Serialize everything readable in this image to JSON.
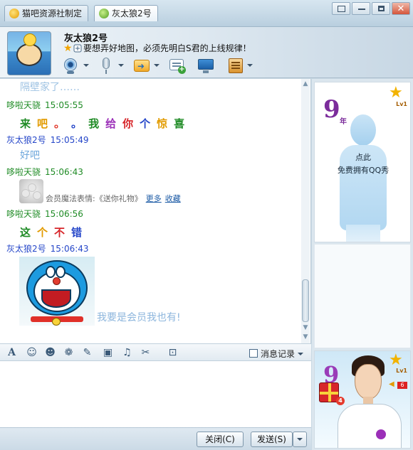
{
  "tabs": [
    {
      "label": "猫吧资源社制定",
      "icon": "cat-user-icon"
    },
    {
      "label": "灰太狼2号",
      "icon": "online-status-icon"
    }
  ],
  "window_controls": {
    "menu": "menu-icon",
    "minimize": "minimize-icon",
    "restore": "restore-icon",
    "close": "✕"
  },
  "header": {
    "name": "灰太狼2号",
    "mood": "要想弄好地图，必须先明白S君的上线规律！"
  },
  "toolbar_icons": [
    "video-call-icon",
    "voice-call-icon",
    "send-file-icon",
    "create-group-chat-icon",
    "remote-assist-icon",
    "app-box-icon"
  ],
  "chat": {
    "faded_top": "隔壁家了……",
    "messages": [
      {
        "sender": "哆啦天骁",
        "time": "15:05:55",
        "text_chars": [
          "来",
          "吧",
          "。",
          "。",
          "我",
          "给",
          "你",
          "个",
          "惊",
          "喜"
        ]
      },
      {
        "sender": "灰太狼2号",
        "time": "15:05:49",
        "text": "好吧"
      },
      {
        "sender": "哆啦天骁",
        "time": "15:06:43",
        "magic_label": "会员魔法表情:《送你礼物》",
        "magic_more": "更多",
        "magic_fav": "收藏"
      },
      {
        "sender": "哆啦天骁",
        "time": "15:06:56",
        "text_chars": [
          "这",
          "个",
          "不",
          "错"
        ]
      },
      {
        "sender": "灰太狼2号",
        "time": "15:06:43",
        "caption": "我要是会员我也有!"
      }
    ],
    "rainbow_colors": [
      "#1f8b25",
      "#e29b00",
      "#e23b2e",
      "#2647c9",
      "#1f8b25",
      "#9b2fb8",
      "#d7262a",
      "#2647c9",
      "#e29b00",
      "#1f8b25"
    ],
    "rainbow2_colors": [
      "#1f8b25",
      "#e29b00",
      "#d7262a",
      "#2647c9"
    ]
  },
  "input_toolbar": {
    "icons": [
      "font-icon",
      "emoticon-icon",
      "member-emoticon-icon",
      "magic-emoticon-icon",
      "handwriting-icon",
      "image-icon",
      "music-icon",
      "screenshot-icon",
      "toolbox-icon"
    ],
    "history_label": "消息记录"
  },
  "buttons": {
    "close": "关闭(C)",
    "send": "发送(S)"
  },
  "right_panel": {
    "years": "9",
    "years_unit": "年",
    "level": "Lv1",
    "tap_text": "点此",
    "free_show_text": "免费拥有QQ秀",
    "gift_count": "4",
    "volume_level": "6"
  }
}
